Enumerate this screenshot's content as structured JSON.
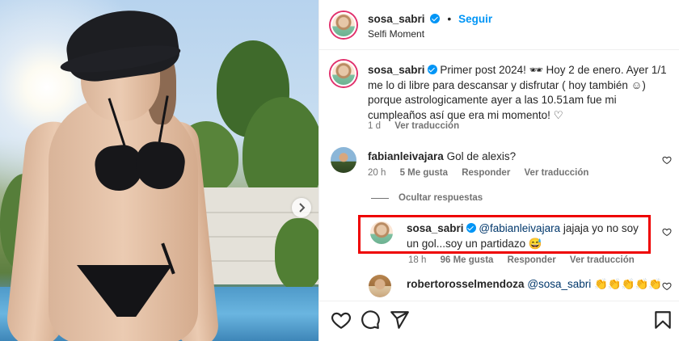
{
  "post": {
    "author": "sosa_sabri",
    "follow_label": "Seguir",
    "location": "Selfi Moment",
    "dot": "•"
  },
  "caption": {
    "author": "sosa_sabri",
    "text": "Primer post 2024! 🕶 Hoy 2 de enero. Ayer 1/1 me lo di libre para descansar y disfrutar ( hoy también ☺) porque astrologicamente ayer a las 10.51am fue mi cumpleaños así que era mi momento! ♡",
    "time": "1 d",
    "translate": "Ver traducción"
  },
  "comments": [
    {
      "author": "fabianleivajara",
      "text": "Gol de alexis?",
      "time": "20 h",
      "likes": "5 Me gusta",
      "reply": "Responder",
      "translate": "Ver traducción"
    }
  ],
  "hide_replies": "Ocultar respuestas",
  "reply": {
    "author": "sosa_sabri",
    "mention": "@fabianleivajara",
    "text": " jajaja yo no soy un gol...soy un partidazo 😅",
    "time": "18 h",
    "likes": "96 Me gusta",
    "reply": "Responder",
    "translate": "Ver traducción"
  },
  "comment3": {
    "author": "robertorosselmendoza",
    "mention": "@sosa_sabri",
    "text": " 👏👏👏👏👏"
  },
  "colors": {
    "link": "#0095f6",
    "highlight": "#e00000",
    "muted": "#737373"
  },
  "icons": [
    "chevron-right-icon",
    "verified-icon",
    "heart-icon",
    "comment-icon",
    "share-icon",
    "bookmark-icon"
  ]
}
